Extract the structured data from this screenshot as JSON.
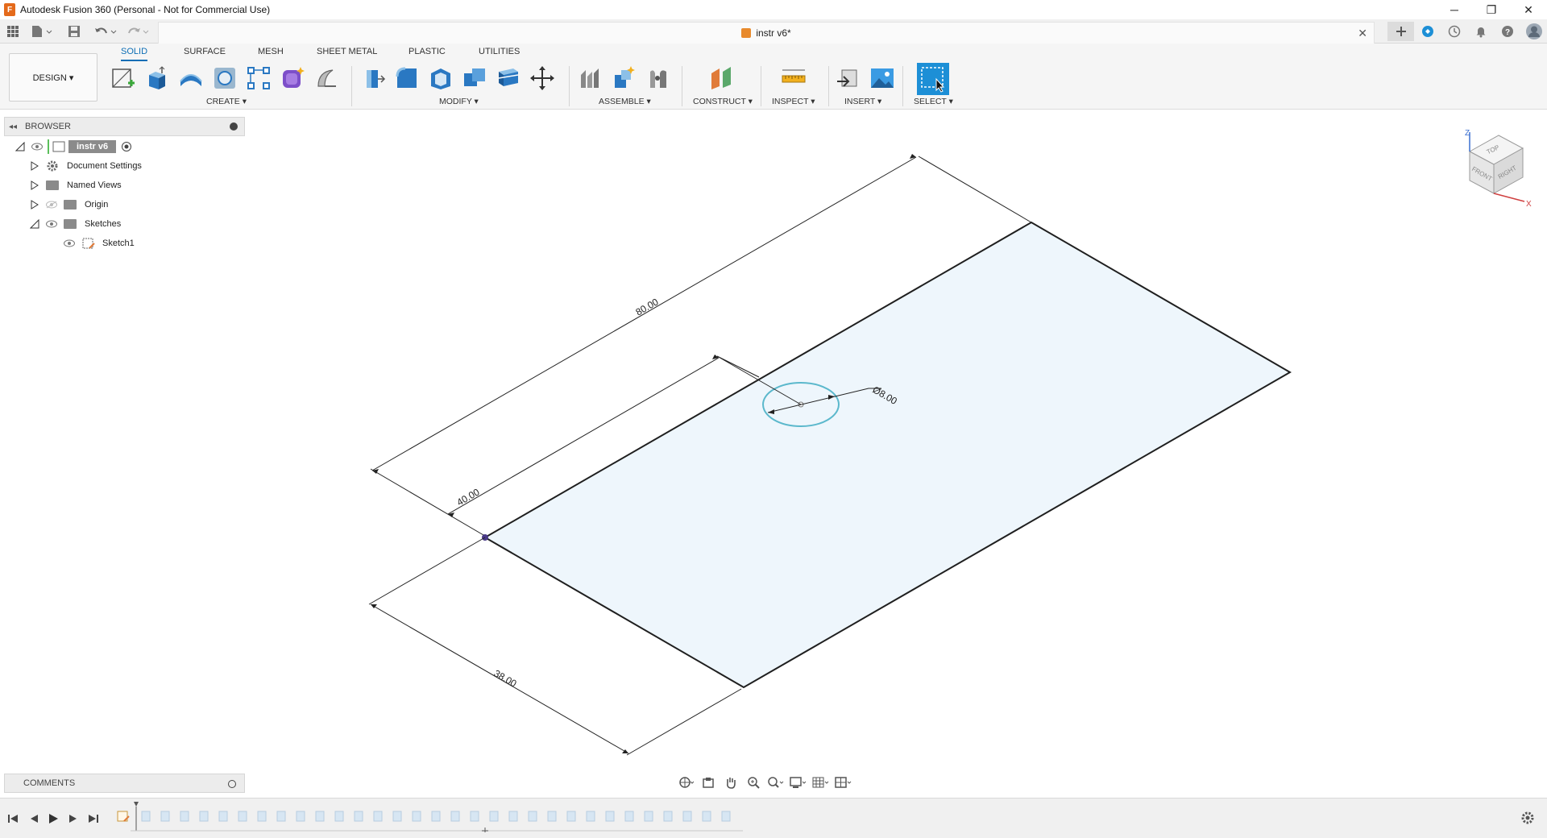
{
  "window": {
    "title": "Autodesk Fusion 360 (Personal - Not for Commercial Use)",
    "minimize": "─",
    "restore": "❐",
    "close": "✕"
  },
  "document": {
    "tab_name": "instr v6*",
    "tab_close": "✕"
  },
  "workspace": {
    "label": "DESIGN ▾"
  },
  "ribbon": {
    "tabs": [
      "SOLID",
      "SURFACE",
      "MESH",
      "SHEET METAL",
      "PLASTIC",
      "UTILITIES"
    ],
    "active_tab": "SOLID",
    "groups": {
      "create": "CREATE ▾",
      "modify": "MODIFY ▾",
      "assemble": "ASSEMBLE ▾",
      "construct": "CONSTRUCT ▾",
      "inspect": "INSPECT ▾",
      "insert": "INSERT ▾",
      "select": "SELECT ▾"
    }
  },
  "browser": {
    "title": "BROWSER",
    "root": "instr v6",
    "items": [
      {
        "label": "Document Settings"
      },
      {
        "label": "Named Views"
      },
      {
        "label": "Origin"
      },
      {
        "label": "Sketches"
      },
      {
        "label": "Sketch1"
      }
    ]
  },
  "comments": {
    "title": "COMMENTS"
  },
  "sketch": {
    "dim_length": "80.00",
    "dim_offset": "40.00",
    "dim_width": "38.00",
    "dim_diameter": "Ø8.00"
  },
  "viewcube": {
    "top": "TOP",
    "front": "FRONT",
    "right": "RIGHT",
    "axis_z": "Z",
    "axis_x": "X"
  },
  "colors": {
    "accent": "#0d6eb5",
    "sketch_fill": "#eef6fc",
    "circle": "#5bb8cc",
    "select_blue": "#1d8fd6"
  }
}
